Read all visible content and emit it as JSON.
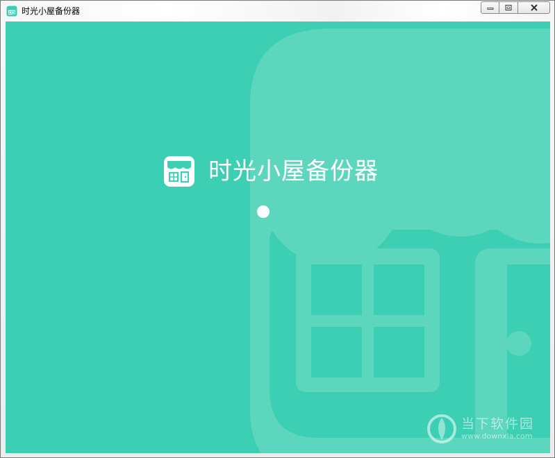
{
  "window": {
    "title": "时光小屋备份器",
    "icon": "app-shop-icon",
    "buttons": {
      "minimize": "minimize-icon",
      "maximize": "maximize-icon",
      "close": "close-icon"
    }
  },
  "splash": {
    "app_name": "时光小屋备份器",
    "logo": "shop-logo-icon",
    "loading": "loading-dot"
  },
  "watermark": {
    "name": "当下软件园",
    "url": "www.downxia.com"
  },
  "colors": {
    "background": "#3dcfb3",
    "decor": "#5dd6be",
    "text": "#ffffff"
  }
}
